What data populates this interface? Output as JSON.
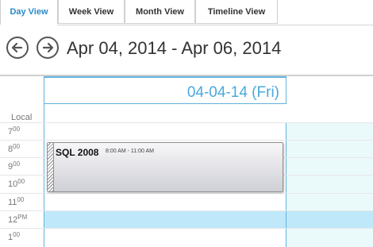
{
  "tabs": [
    {
      "label": "Day View",
      "active": true
    },
    {
      "label": "Week View",
      "active": false
    },
    {
      "label": "Month View",
      "active": false
    },
    {
      "label": "Timeline View",
      "active": false
    }
  ],
  "header": {
    "date_range": "Apr 04, 2014 - Apr 06, 2014",
    "prev_icon": "arrow-left-circle-icon",
    "next_icon": "arrow-right-circle-icon"
  },
  "calendar": {
    "day_title": "04-04-14 (Fri)",
    "timezone_label": "Local",
    "hours": [
      {
        "num": "7",
        "suffix": "00"
      },
      {
        "num": "8",
        "suffix": "00"
      },
      {
        "num": "9",
        "suffix": "00"
      },
      {
        "num": "10",
        "suffix": "00"
      },
      {
        "num": "11",
        "suffix": "00"
      },
      {
        "num": "12",
        "suffix": "PM"
      },
      {
        "num": "1",
        "suffix": "00"
      }
    ]
  },
  "event": {
    "title": "SQL 2008",
    "time": "8:00 AM - 11:00 AM"
  },
  "colors": {
    "accent": "#4aa8dd",
    "grid_background": "#eafafb",
    "noon_highlight": "#bfe9fa"
  }
}
